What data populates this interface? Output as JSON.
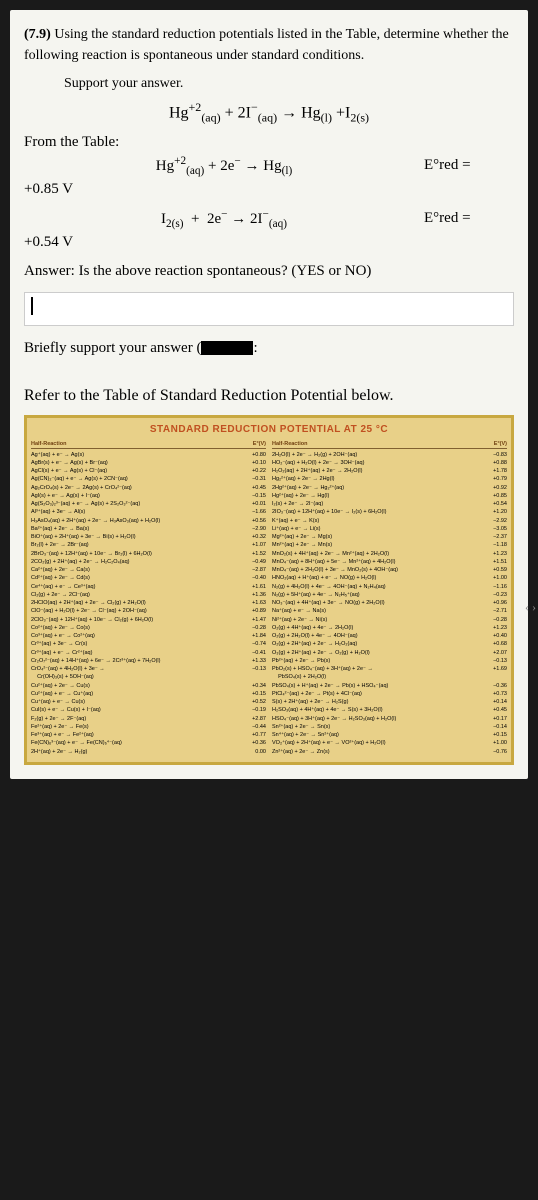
{
  "problem": {
    "number": "(7.9)",
    "text": "Using the standard reduction potentials listed in the Table, determine whether the following reaction is spontaneous under standard conditions.",
    "support": "Support your answer.",
    "main_formula_html": "Hg<span class='sup'>+2</span><span class='sub'>(aq)</span> + 2I<span class='sup'>−</span><span class='sub'>(aq)</span> → Hg<span class='sub'>(l)</span> +I<span class='sub'>2(s)</span>",
    "from_table": "From the Table:",
    "eq1_html": "Hg<span class='sup'>+2</span><span class='sub'>(aq)</span> + 2e<span class='sup'>−</span> → Hg<span class='sub'>(l)</span>",
    "eq1_e": "E°red =",
    "eq1_v": "+0.85 V",
    "eq2_html": "I<span class='sub'>2(s)</span> &nbsp;+&nbsp; 2e<span class='sup'>−</span> → 2I<span class='sup'>−</span><span class='sub'>(aq)</span>",
    "eq2_e": "E°red =",
    "eq2_v": "+0.54 V",
    "answer_q": "Answer:  Is the above reaction spontaneous? (YES or NO)",
    "brief": "Briefly support your answer (",
    "brief_end": ":",
    "refer": "Refer to the Table of Standard Reduction Potential below.",
    "table_title": "STANDARD REDUCTION POTENTIAL AT 25 °C",
    "header_rxn": "Half-Reaction",
    "header_e": "E°(V)",
    "left_rows": [
      {
        "r": "Ag⁺(aq) + e⁻ → Ag(s)",
        "e": "+0.80"
      },
      {
        "r": "AgBr(s) + e⁻ → Ag(s) + Br⁻(aq)",
        "e": "+0.10"
      },
      {
        "r": "AgCl(s) + e⁻ → Ag(s) + Cl⁻(aq)",
        "e": "+0.22"
      },
      {
        "r": "Ag(CN)₂⁻(aq) + e⁻ → Ag(s) + 2CN⁻(aq)",
        "e": "−0.31"
      },
      {
        "r": "Ag₂CrO₄(s) + 2e⁻ → 2Ag(s) + CrO₄²⁻(aq)",
        "e": "+0.45"
      },
      {
        "r": "AgI(s) + e⁻ → Ag(s) + I⁻(aq)",
        "e": "−0.15"
      },
      {
        "r": "Ag(S₂O₃)₂³⁻(aq) + e⁻ → Ag(s) + 2S₂O₃²⁻(aq)",
        "e": "+0.01"
      },
      {
        "r": "Al³⁺(aq) + 3e⁻ → Al(s)",
        "e": "−1.66"
      },
      {
        "r": "H₃AsO₄(aq) + 2H⁺(aq) + 2e⁻ → H₃AsO₃(aq) + H₂O(l)",
        "e": "+0.56"
      },
      {
        "r": "Ba²⁺(aq) + 2e⁻ → Ba(s)",
        "e": "−2.90"
      },
      {
        "r": "BiO⁺(aq) + 2H⁺(aq) + 3e⁻ → Bi(s) + H₂O(l)",
        "e": "+0.32"
      },
      {
        "r": "Br₂(l) + 2e⁻ → 2Br⁻(aq)",
        "e": "+1.07"
      },
      {
        "r": "2BrO₃⁻(aq) + 12H⁺(aq) + 10e⁻ → Br₂(l) + 6H₂O(l)",
        "e": "+1.52"
      },
      {
        "r": "2CO₂(g) + 2H⁺(aq) + 2e⁻ → H₂C₂O₄(aq)",
        "e": "−0.49"
      },
      {
        "r": "Ca²⁺(aq) + 2e⁻ → Ca(s)",
        "e": "−2.87"
      },
      {
        "r": "Cd²⁺(aq) + 2e⁻ → Cd(s)",
        "e": "−0.40"
      },
      {
        "r": "Ce⁴⁺(aq) + e⁻ → Ce³⁺(aq)",
        "e": "+1.61"
      },
      {
        "r": "Cl₂(g) + 2e⁻ → 2Cl⁻(aq)",
        "e": "+1.36"
      },
      {
        "r": "2HClO(aq) + 2H⁺(aq) + 2e⁻ → Cl₂(g) + 2H₂O(l)",
        "e": "+1.63"
      },
      {
        "r": "ClO⁻(aq) + H₂O(l) + 2e⁻ → Cl⁻(aq) + 2OH⁻(aq)",
        "e": "+0.89"
      },
      {
        "r": "2ClO₃⁻(aq) + 12H⁺(aq) + 10e⁻ → Cl₂(g) + 6H₂O(l)",
        "e": "+1.47"
      },
      {
        "r": "Co²⁺(aq) + 2e⁻ → Co(s)",
        "e": "−0.28"
      },
      {
        "r": "Co³⁺(aq) + e⁻ → Co²⁺(aq)",
        "e": "+1.84"
      },
      {
        "r": "Cr³⁺(aq) + 3e⁻ → Cr(s)",
        "e": "−0.74"
      },
      {
        "r": "Cr³⁺(aq) + e⁻ → Cr²⁺(aq)",
        "e": "−0.41"
      },
      {
        "r": "Cr₂O₇²⁻(aq) + 14H⁺(aq) + 6e⁻ → 2Cr³⁺(aq) + 7H₂O(l)",
        "e": "+1.33"
      },
      {
        "r": "CrO₄²⁻(aq) + 4H₂O(l) + 3e⁻ →",
        "e": "−0.13"
      },
      {
        "r": "&nbsp;&nbsp;&nbsp;&nbsp;Cr(OH)₃(s) + 5OH⁻(aq)",
        "e": ""
      },
      {
        "r": "Cu²⁺(aq) + 2e⁻ → Cu(s)",
        "e": "+0.34"
      },
      {
        "r": "Cu²⁺(aq) + e⁻ → Cu⁺(aq)",
        "e": "+0.15"
      },
      {
        "r": "Cu⁺(aq) + e⁻ → Cu(s)",
        "e": "+0.52"
      },
      {
        "r": "CuI(s) + e⁻ → Cu(s) + I⁻(aq)",
        "e": "−0.19"
      },
      {
        "r": "F₂(g) + 2e⁻ → 2F⁻(aq)",
        "e": "+2.87"
      },
      {
        "r": "Fe²⁺(aq) + 2e⁻ → Fe(s)",
        "e": "−0.44"
      },
      {
        "r": "Fe³⁺(aq) + e⁻ → Fe²⁺(aq)",
        "e": "+0.77"
      },
      {
        "r": "Fe(CN)₆³⁻(aq) + e⁻ → Fe(CN)₆⁴⁻(aq)",
        "e": "+0.36"
      },
      {
        "r": "2H⁺(aq) + 2e⁻ → H₂(g)",
        "e": "0.00"
      }
    ],
    "right_rows": [
      {
        "r": "2H₂O(l) + 2e⁻ → H₂(g) + 2OH⁻(aq)",
        "e": "−0.83"
      },
      {
        "r": "HO₂⁻(aq) + H₂O(l) + 2e⁻ → 3OH⁻(aq)",
        "e": "+0.88"
      },
      {
        "r": "H₂O₂(aq) + 2H⁺(aq) + 2e⁻ → 2H₂O(l)",
        "e": "+1.78"
      },
      {
        "r": "Hg₂²⁺(aq) + 2e⁻ → 2Hg(l)",
        "e": "+0.79"
      },
      {
        "r": "2Hg²⁺(aq) + 2e⁻ → Hg₂²⁺(aq)",
        "e": "+0.92"
      },
      {
        "r": "Hg²⁺(aq) + 2e⁻ → Hg(l)",
        "e": "+0.85"
      },
      {
        "r": "I₂(s) + 2e⁻ → 2I⁻(aq)",
        "e": "+0.54"
      },
      {
        "r": "2IO₃⁻(aq) + 12H⁺(aq) + 10e⁻ → I₂(s) + 6H₂O(l)",
        "e": "+1.20"
      },
      {
        "r": "K⁺(aq) + e⁻ → K(s)",
        "e": "−2.92"
      },
      {
        "r": "Li⁺(aq) + e⁻ → Li(s)",
        "e": "−3.05"
      },
      {
        "r": "Mg²⁺(aq) + 2e⁻ → Mg(s)",
        "e": "−2.37"
      },
      {
        "r": "Mn²⁺(aq) + 2e⁻ → Mn(s)",
        "e": "−1.18"
      },
      {
        "r": "MnO₂(s) + 4H⁺(aq) + 2e⁻ → Mn²⁺(aq) + 2H₂O(l)",
        "e": "+1.23"
      },
      {
        "r": "MnO₄⁻(aq) + 8H⁺(aq) + 5e⁻ → Mn²⁺(aq) + 4H₂O(l)",
        "e": "+1.51"
      },
      {
        "r": "MnO₄⁻(aq) + 2H₂O(l) + 3e⁻ → MnO₂(s) + 4OH⁻(aq)",
        "e": "+0.59"
      },
      {
        "r": "HNO₂(aq) + H⁺(aq) + e⁻ → NO(g) + H₂O(l)",
        "e": "+1.00"
      },
      {
        "r": "N₂(g) + 4H₂O(l) + 4e⁻ → 4OH⁻(aq) + N₂H₄(aq)",
        "e": "−1.16"
      },
      {
        "r": "N₂(g) + 5H⁺(aq) + 4e⁻ → N₂H₅⁺(aq)",
        "e": "−0.23"
      },
      {
        "r": "NO₃⁻(aq) + 4H⁺(aq) + 3e⁻ → NO(g) + 2H₂O(l)",
        "e": "+0.96"
      },
      {
        "r": "Na⁺(aq) + e⁻ → Na(s)",
        "e": "−2.71"
      },
      {
        "r": "Ni²⁺(aq) + 2e⁻ → Ni(s)",
        "e": "−0.28"
      },
      {
        "r": "O₂(g) + 4H⁺(aq) + 4e⁻ → 2H₂O(l)",
        "e": "+1.23"
      },
      {
        "r": "O₂(g) + 2H₂O(l) + 4e⁻ → 4OH⁻(aq)",
        "e": "+0.40"
      },
      {
        "r": "O₂(g) + 2H⁺(aq) + 2e⁻ → H₂O₂(aq)",
        "e": "+0.68"
      },
      {
        "r": "O₃(g) + 2H⁺(aq) + 2e⁻ → O₂(g) + H₂O(l)",
        "e": "+2.07"
      },
      {
        "r": "Pb²⁺(aq) + 2e⁻ → Pb(s)",
        "e": "−0.13"
      },
      {
        "r": "PbO₂(s) + HSO₄⁻(aq) + 3H⁺(aq) + 2e⁻ →",
        "e": "+1.69"
      },
      {
        "r": "&nbsp;&nbsp;&nbsp;&nbsp;PbSO₄(s) + 2H₂O(l)",
        "e": ""
      },
      {
        "r": "PbSO₄(s) + H⁺(aq) + 2e⁻ → Pb(s) + HSO₄⁻(aq)",
        "e": "−0.36"
      },
      {
        "r": "PtCl₄²⁻(aq) + 2e⁻ → Pt(s) + 4Cl⁻(aq)",
        "e": "+0.73"
      },
      {
        "r": "S(s) + 2H⁺(aq) + 2e⁻ → H₂S(g)",
        "e": "+0.14"
      },
      {
        "r": "H₂SO₃(aq) + 4H⁺(aq) + 4e⁻ → S(s) + 3H₂O(l)",
        "e": "+0.45"
      },
      {
        "r": "HSO₄⁻(aq) + 3H⁺(aq) + 2e⁻ → H₂SO₃(aq) + H₂O(l)",
        "e": "+0.17"
      },
      {
        "r": "Sn²⁺(aq) + 2e⁻ → Sn(s)",
        "e": "−0.14"
      },
      {
        "r": "Sn⁴⁺(aq) + 2e⁻ → Sn²⁺(aq)",
        "e": "+0.15"
      },
      {
        "r": "VO₂⁺(aq) + 2H⁺(aq) + e⁻ → VO²⁺(aq) + H₂O(l)",
        "e": "+1.00"
      },
      {
        "r": "Zn²⁺(aq) + 2e⁻ → Zn(s)",
        "e": "−0.76"
      }
    ]
  }
}
